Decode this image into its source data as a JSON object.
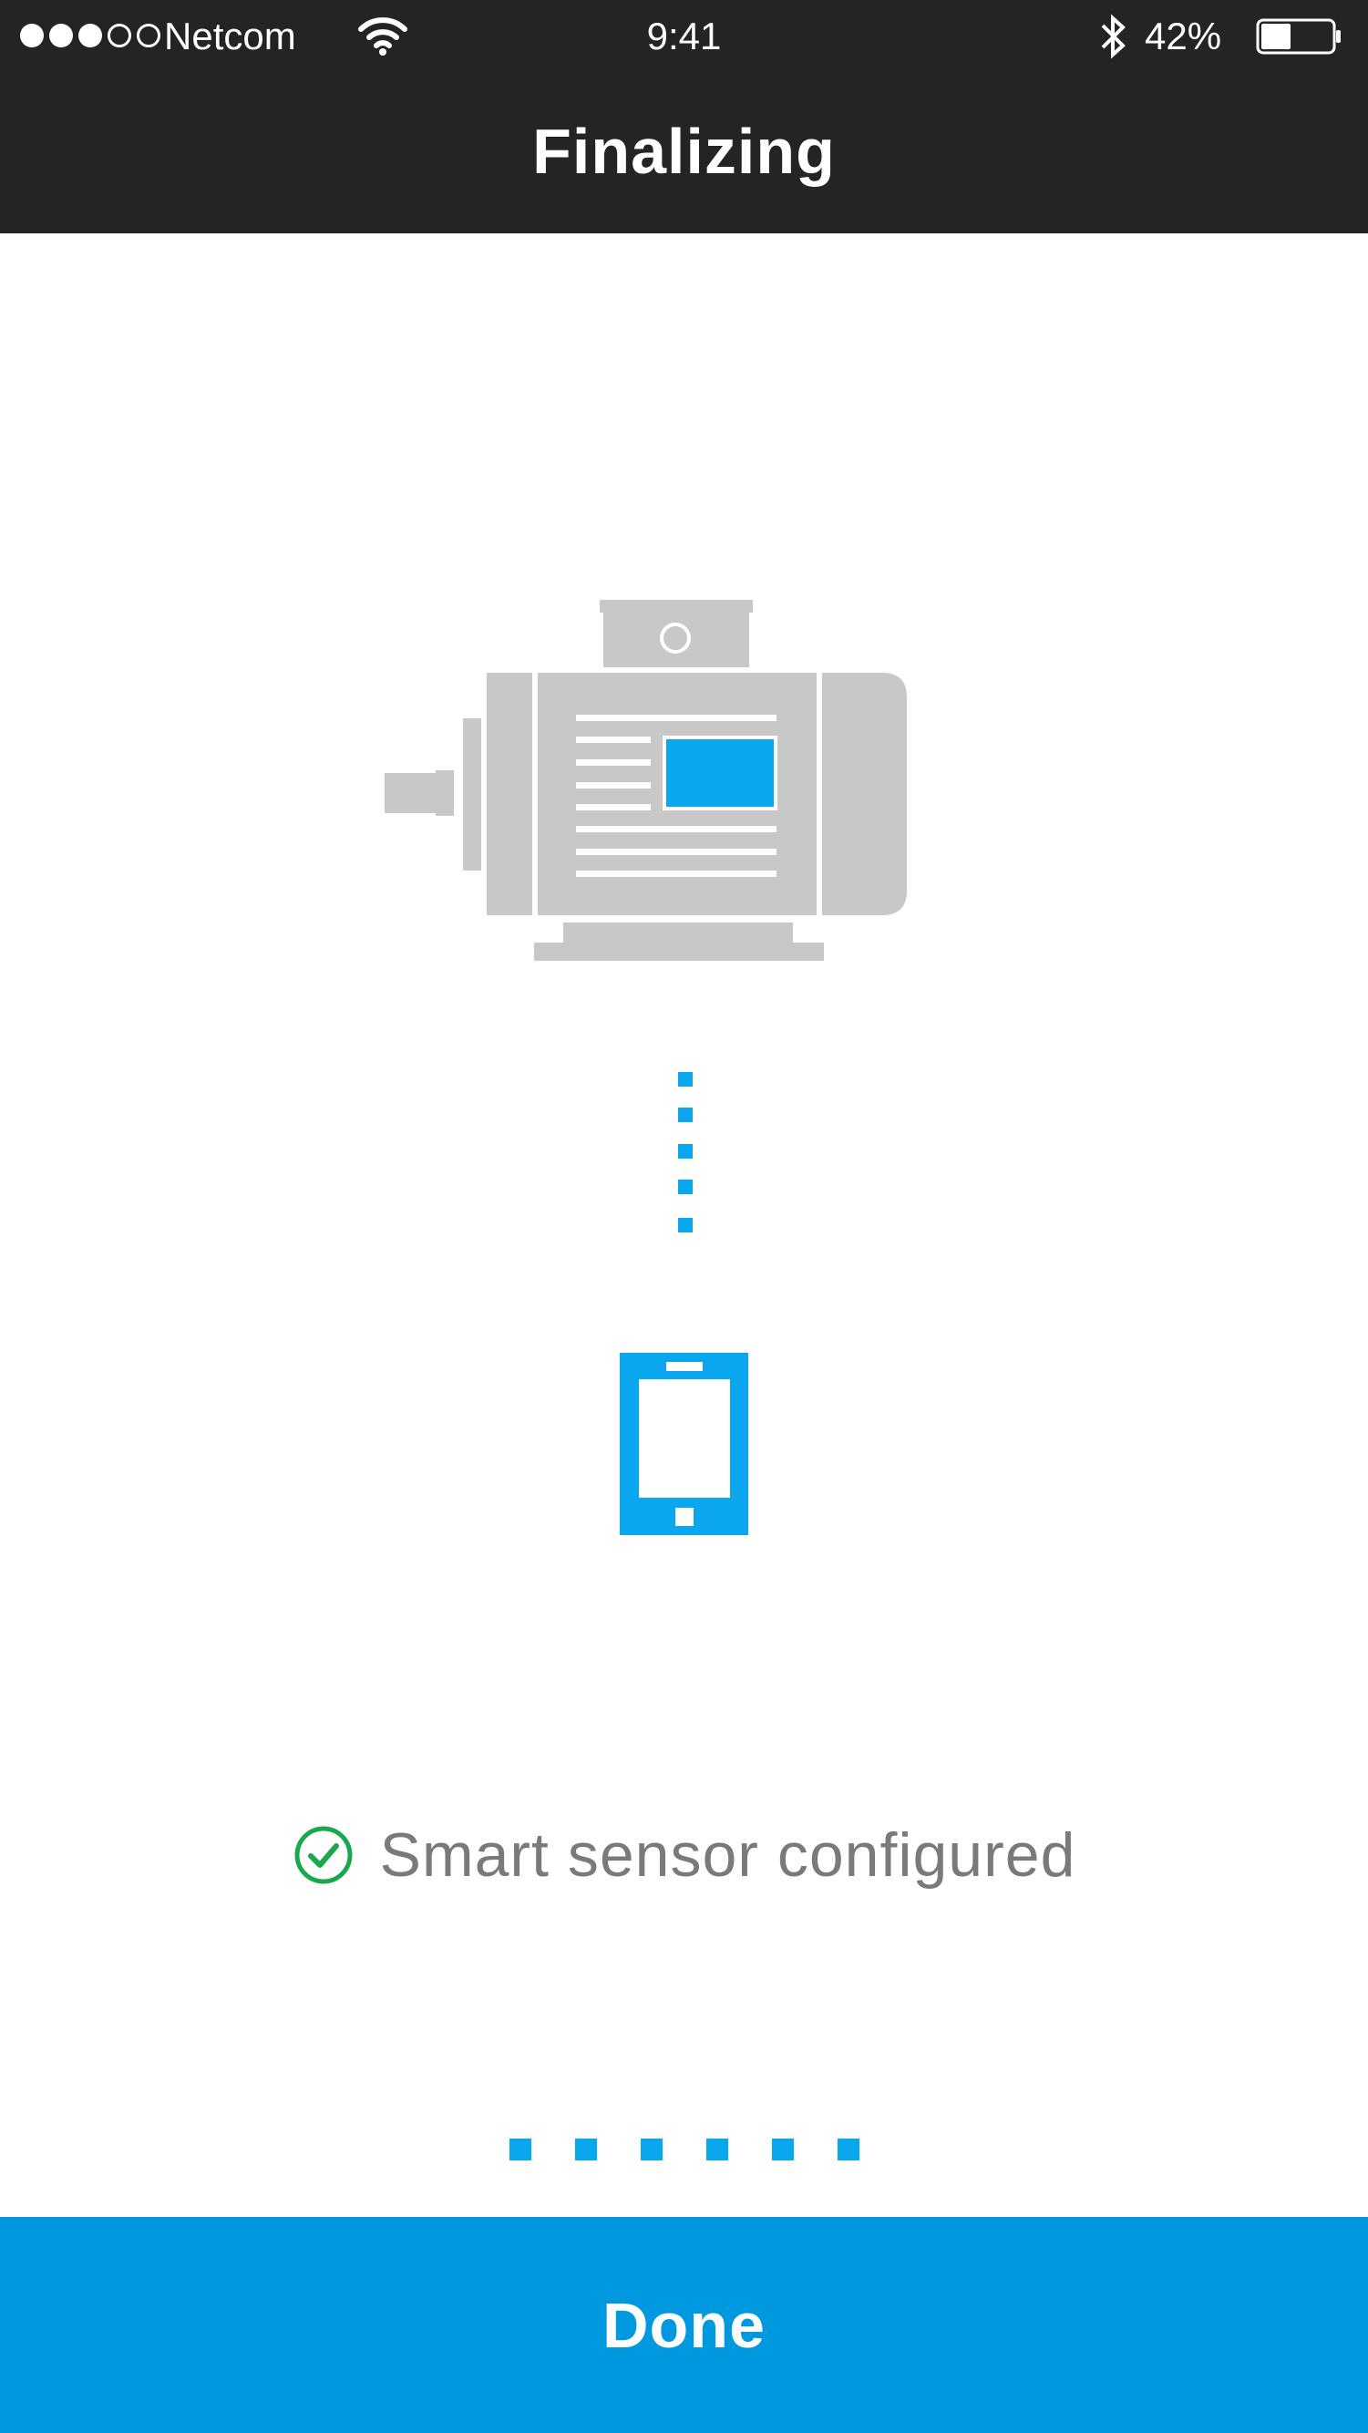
{
  "status_bar": {
    "signal_bars_filled": 3,
    "signal_bars_total": 5,
    "carrier": "Netcom",
    "wifi_icon": "wifi-icon",
    "time": "9:41",
    "bluetooth_icon": "bluetooth-icon",
    "battery_percent": "42%",
    "battery_level": 0.42
  },
  "nav": {
    "title": "Finalizing"
  },
  "illustration": {
    "motor_icon": "electric-motor-icon",
    "link_icon": "dotted-connection-icon",
    "phone_icon": "smartphone-icon",
    "colors": {
      "motor": "#c8c8c8",
      "accent": "#0aa7ef"
    }
  },
  "status": {
    "icon": "check-circle-icon",
    "text": "Smart sensor configured",
    "color": "#1aa84f"
  },
  "progress": {
    "dot_count": 6
  },
  "footer": {
    "done_label": "Done",
    "color": "#0099e0"
  }
}
